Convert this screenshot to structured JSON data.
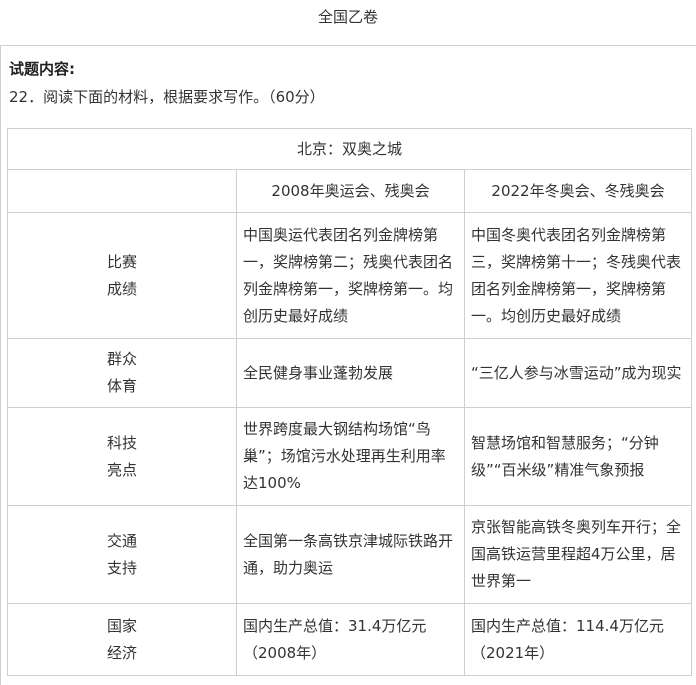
{
  "page_title": "全国乙卷",
  "question": {
    "heading": "试题内容:",
    "prompt": "22．阅读下面的材料，根据要求写作。（60分）"
  },
  "table": {
    "caption": "北京：双奥之城",
    "headers": [
      "",
      "2008年奥运会、残奥会",
      "2022年冬奥会、冬残奥会"
    ],
    "rows": [
      {
        "label_line1": "比赛",
        "label_line2": "成绩",
        "col2008": "中国奥运代表团名列金牌榜第一，奖牌榜第二；残奥代表团名列金牌榜第一，奖牌榜第一。均创历史最好成绩",
        "col2022": "中国冬奥代表团名列金牌榜第三，奖牌榜第十一；冬残奥代表团名列金牌榜第一，奖牌榜第一。均创历史最好成绩"
      },
      {
        "label_line1": "群众",
        "label_line2": "体育",
        "col2008": "全民健身事业蓬勃发展",
        "col2022": "“三亿人参与冰雪运动”成为现实"
      },
      {
        "label_line1": "科技",
        "label_line2": "亮点",
        "col2008": "世界跨度最大钢结构场馆“鸟巢”；场馆污水处理再生利用率达100%",
        "col2022": "智慧场馆和智慧服务；“分钟级”“百米级”精准气象预报"
      },
      {
        "label_line1": "交通",
        "label_line2": "支持",
        "col2008": "全国第一条高铁京津城际铁路开通，助力奥运",
        "col2022": "京张智能高铁冬奥列车开行；全国高铁运营里程超4万公里，居世界第一"
      },
      {
        "label_line1": "国家",
        "label_line2": "经济",
        "col2008": "国内生产总值：31.4万亿元（2008年）",
        "col2022": "国内生产总值：114.4万亿元（2021年）"
      }
    ]
  }
}
